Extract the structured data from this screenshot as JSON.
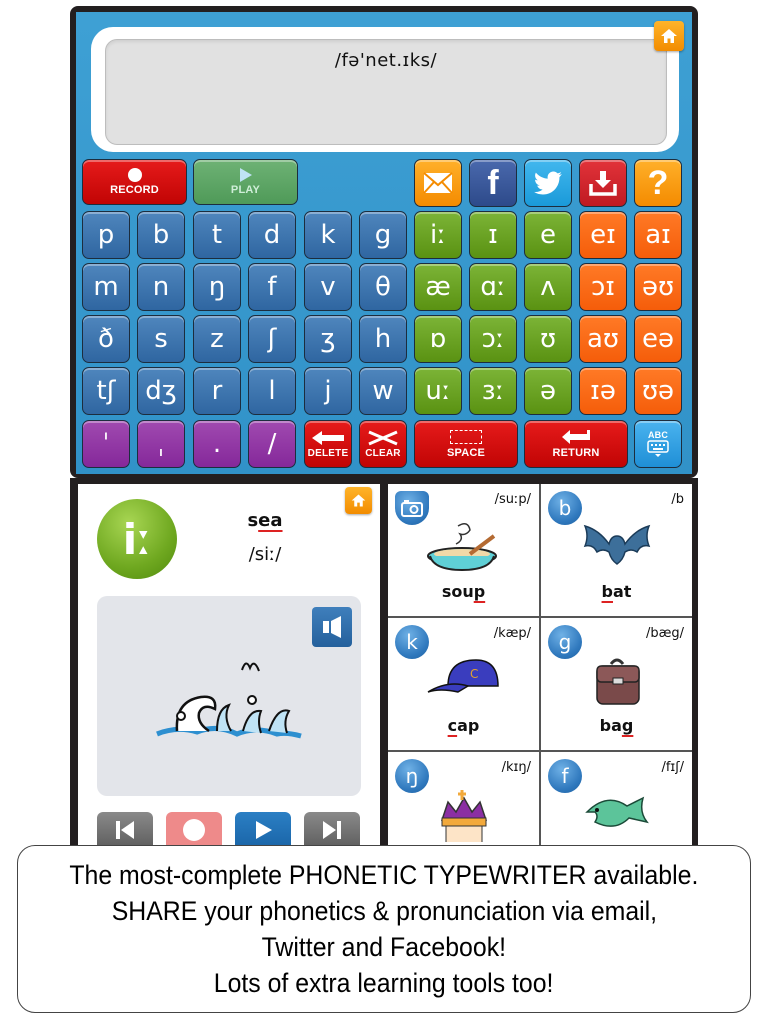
{
  "display": {
    "text": "/fə'net.ɪks/"
  },
  "toolbar": {
    "record_label": "RECORD",
    "play_label": "PLAY",
    "share_icons": [
      "email-icon",
      "facebook-icon",
      "twitter-icon",
      "download-icon",
      "help-icon"
    ]
  },
  "keyboard": {
    "consonant_rows": [
      [
        "p",
        "b",
        "t",
        "d",
        "k",
        "g"
      ],
      [
        "m",
        "n",
        "ŋ",
        "f",
        "v",
        "θ"
      ],
      [
        "ð",
        "s",
        "z",
        "ʃ",
        "ʒ",
        "h"
      ],
      [
        "tʃ",
        "dʒ",
        "r",
        "l",
        "j",
        "w"
      ]
    ],
    "vowel_rows": [
      [
        "iː",
        "ɪ",
        "e"
      ],
      [
        "æ",
        "ɑː",
        "ʌ"
      ],
      [
        "ɒ",
        "ɔː",
        "ʊ"
      ],
      [
        "uː",
        "ɜː",
        "ə"
      ]
    ],
    "diphthong_rows": [
      [
        "eɪ",
        "aɪ"
      ],
      [
        "ɔɪ",
        "əʊ"
      ],
      [
        "aʊ",
        "eə"
      ],
      [
        "ɪə",
        "ʊə"
      ]
    ],
    "punctuation": [
      "ˈ",
      "ˌ",
      ".",
      "/"
    ],
    "delete_label": "DELETE",
    "clear_label": "CLEAR",
    "space_label": "SPACE",
    "return_label": "RETURN",
    "abc_label": "ABC"
  },
  "sound_card": {
    "symbol": "iː",
    "word_prefix": "s",
    "word_highlight": "ea",
    "ipa": "/siː/",
    "picture": "sea-waves"
  },
  "word_grid": [
    {
      "letter": "📷",
      "letter_icon": "camera-icon",
      "ipa": "/suːp/",
      "word_pre": "sou",
      "word_hl": "p",
      "word_post": "",
      "picture": "soup"
    },
    {
      "letter": "b",
      "ipa": "/b",
      "word_pre": "",
      "word_hl": "b",
      "word_post": "at",
      "picture": "bat"
    },
    {
      "letter": "k",
      "ipa": "/kæp/",
      "word_pre": "",
      "word_hl": "c",
      "word_post": "ap",
      "picture": "cap"
    },
    {
      "letter": "g",
      "ipa": "/bæg/",
      "word_pre": "ba",
      "word_hl": "g",
      "word_post": "",
      "picture": "bag"
    },
    {
      "letter": "ŋ",
      "ipa": "/kɪŋ/",
      "word_pre": "",
      "word_hl": "",
      "word_post": "",
      "picture": "king"
    },
    {
      "letter": "f",
      "ipa": "/fɪʃ/",
      "word_pre": "",
      "word_hl": "",
      "word_post": "",
      "picture": "fish"
    }
  ],
  "banner": {
    "lines": [
      "The most-complete PHONETIC TYPEWRITER available.",
      "SHARE your phonetics & pronunciation via email,",
      "Twitter and Facebook!",
      "Lots of extra learning tools too!"
    ]
  }
}
